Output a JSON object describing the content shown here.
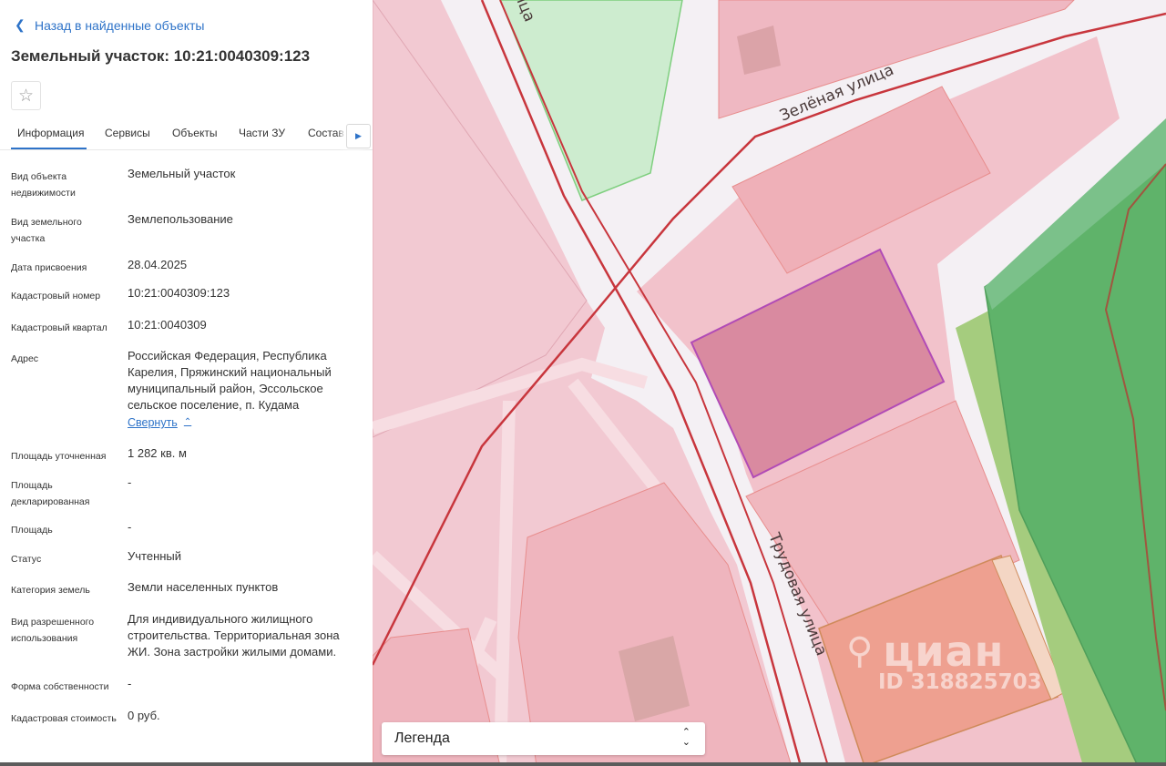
{
  "header": {
    "back_label": "Назад в найденные объекты",
    "title": "Земельный участок: 10:21:0040309:123",
    "favorite_icon": "star-icon"
  },
  "tabs": [
    {
      "label": "Информация",
      "active": true
    },
    {
      "label": "Сервисы"
    },
    {
      "label": "Объекты"
    },
    {
      "label": "Части ЗУ"
    },
    {
      "label": "Состав"
    }
  ],
  "info": {
    "object_type": {
      "label": "Вид объекта недвижимости",
      "value": "Земельный участок"
    },
    "land_type": {
      "label": "Вид земельного участка",
      "value": "Землепользование"
    },
    "date_assigned": {
      "label": "Дата присвоения",
      "value": "28.04.2025"
    },
    "cadastral_number": {
      "label": "Кадастровый номер",
      "value": "10:21:0040309:123"
    },
    "cadastral_quarter": {
      "label": "Кадастровый квартал",
      "value": "10:21:0040309"
    },
    "address": {
      "label": "Адрес",
      "value": "Российская Федерация, Республика Карелия, Пряжинский национальный муниципальный район, Эссольское сельское поселение, п. Кудама",
      "collapse_label": "Свернуть"
    },
    "area_refined": {
      "label": "Площадь уточненная",
      "value": "1 282 кв. м"
    },
    "area_declared": {
      "label": "Площадь декларированная",
      "value": "-"
    },
    "area": {
      "label": "Площадь",
      "value": "-"
    },
    "status": {
      "label": "Статус",
      "value": "Учтенный"
    },
    "land_category": {
      "label": "Категория земель",
      "value": "Земли населенных пунктов"
    },
    "permitted_use": {
      "label": "Вид разрешенного использования",
      "value": "Для индивидуального жилищного строительства. Территориальная зона ЖИ. Зона застройки жилыми домами."
    },
    "ownership": {
      "label": "Форма собственности",
      "value": "-"
    },
    "cadastral_value": {
      "label": "Кадастровая стоимость",
      "value": "0 руб."
    }
  },
  "map": {
    "streets": {
      "zelenaya": "Зелёная  улица",
      "trudovaya": "Трудовая  улица",
      "top": "улица"
    },
    "watermark": {
      "logo": "циан",
      "id": "ID 318825703"
    },
    "legend_label": "Легенда",
    "colors": {
      "parcel_fill": "#f3c7d0",
      "selected_parcel": "#d98aa0",
      "forest": "#5fb36a",
      "road": "#c8363d"
    }
  }
}
